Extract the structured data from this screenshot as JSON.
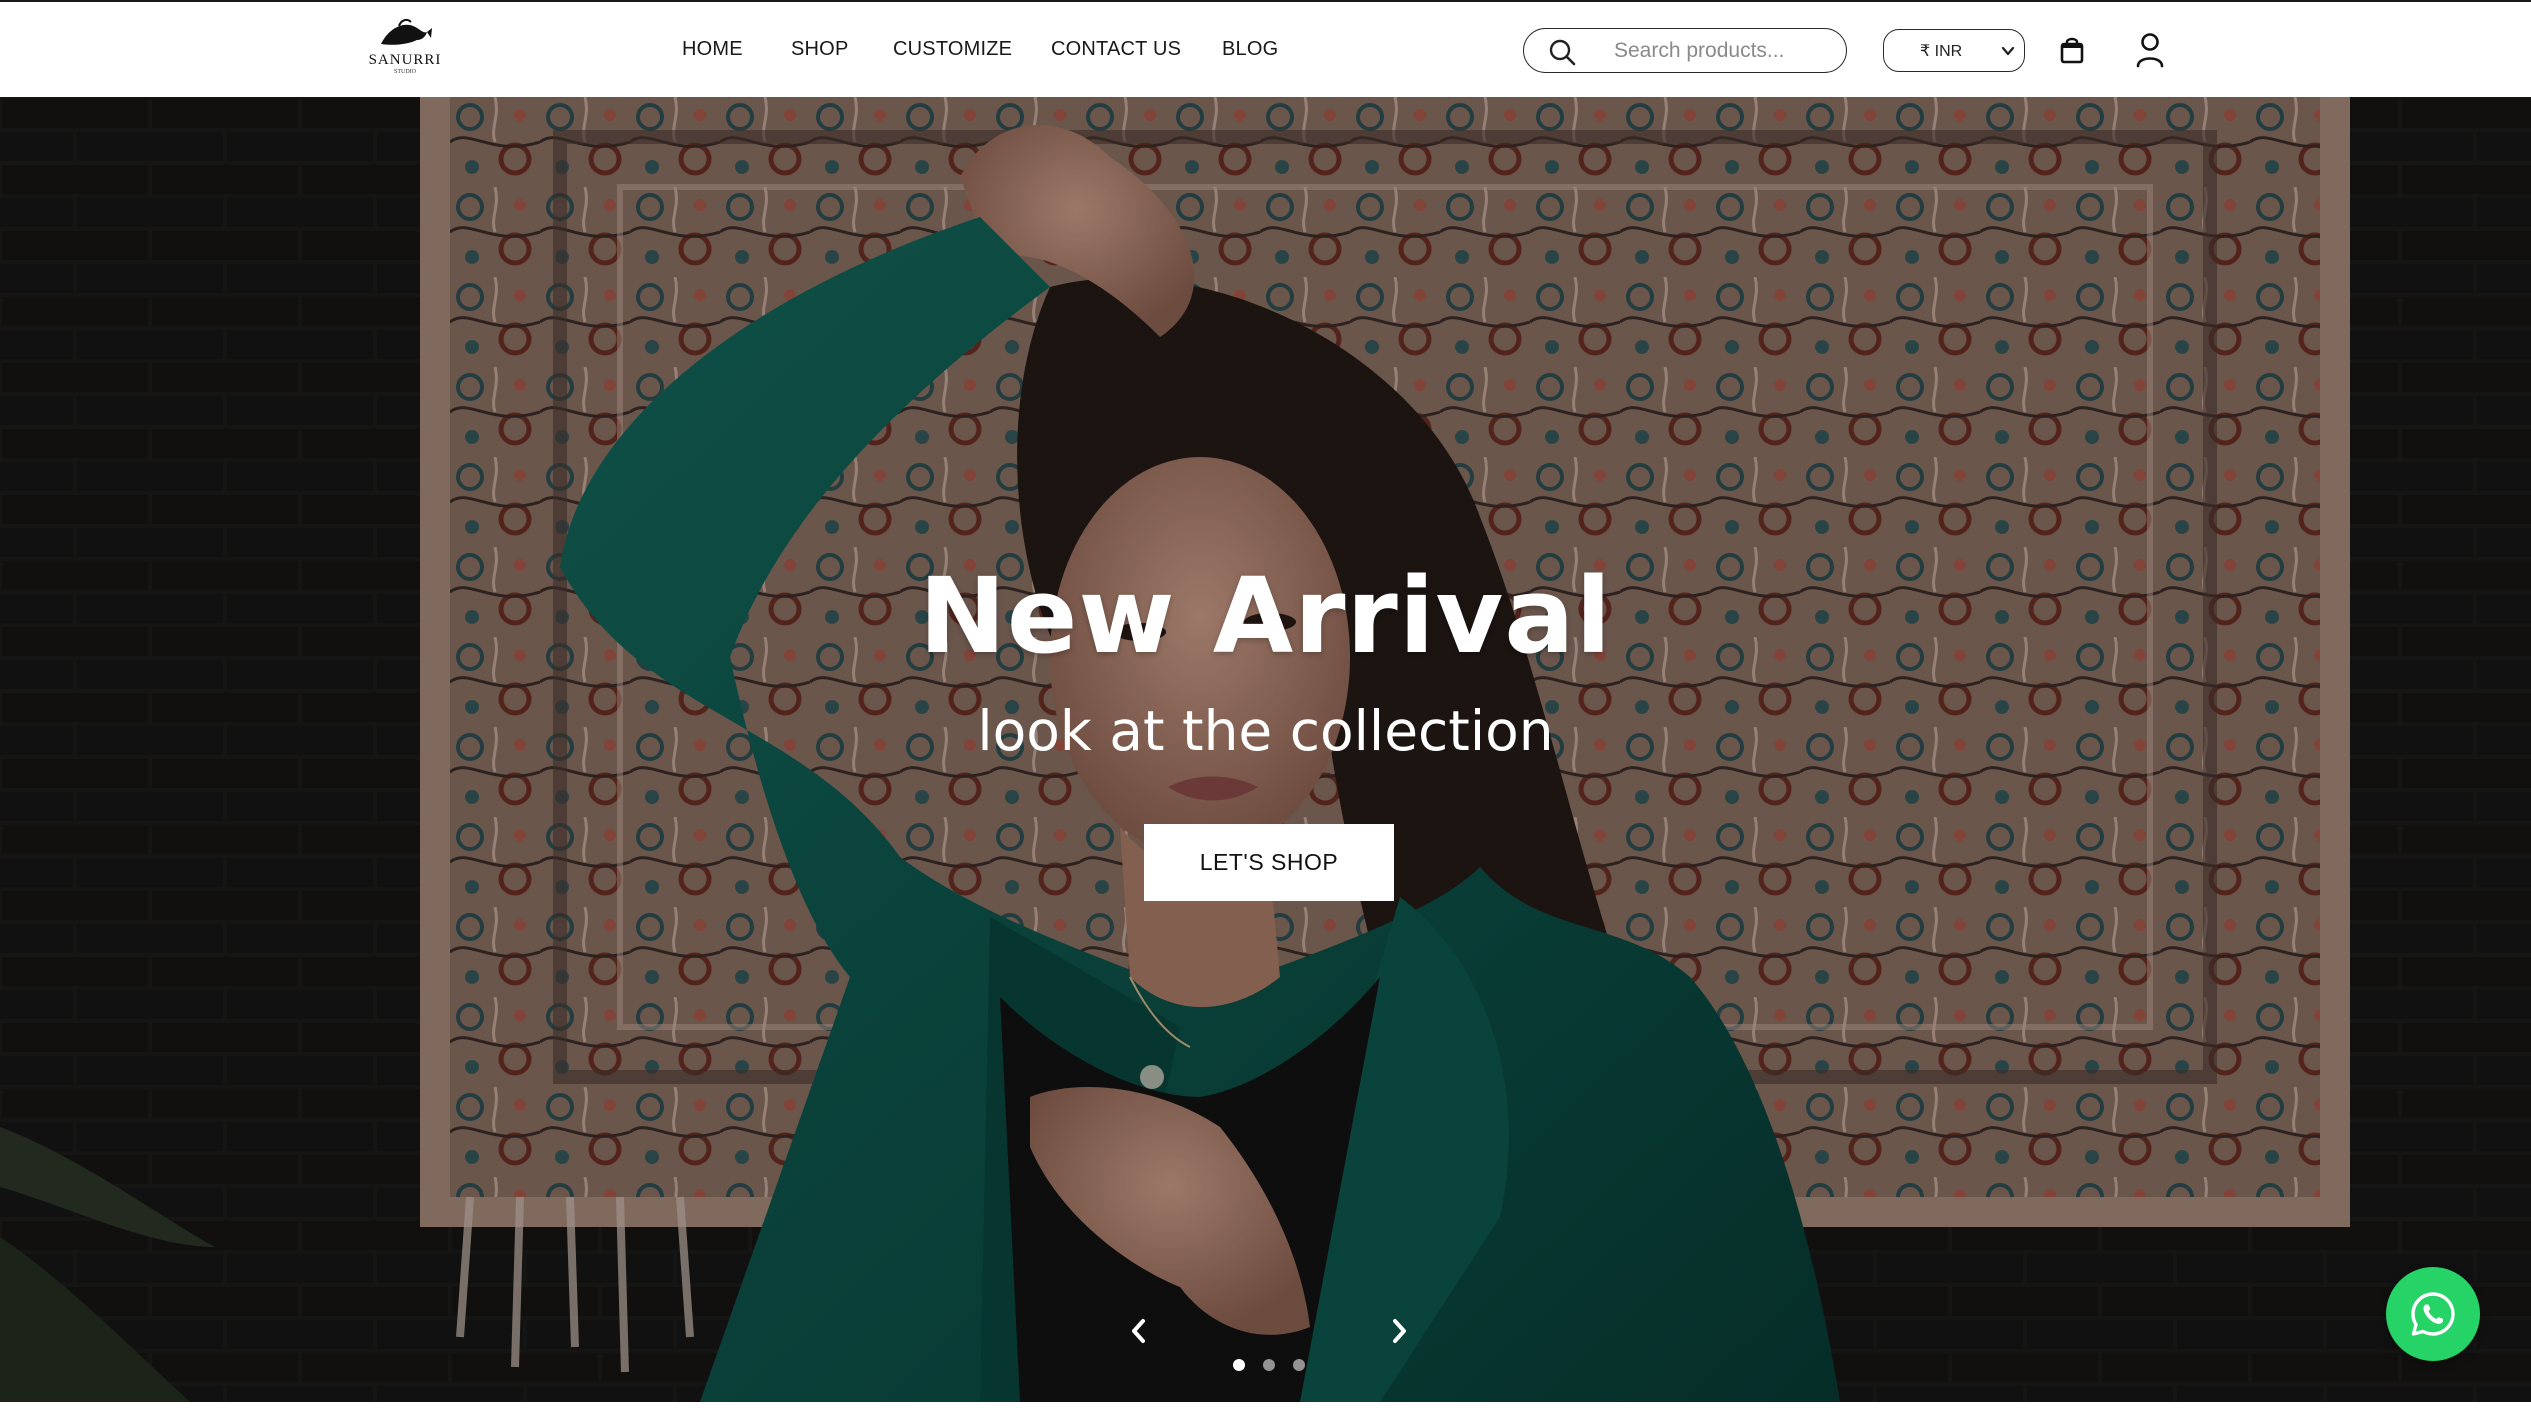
{
  "header": {
    "logo": {
      "name": "SANURRI",
      "sub": "STUDIO"
    },
    "nav": [
      {
        "label": "HOME"
      },
      {
        "label": "SHOP"
      },
      {
        "label": "CUSTOMIZE"
      },
      {
        "label": "CONTACT US"
      },
      {
        "label": "BLOG"
      }
    ],
    "search": {
      "placeholder": "Search products...",
      "icon": "search-icon"
    },
    "currency": {
      "selected": "₹ INR"
    },
    "cart_icon": "shopping-bag-icon",
    "account_icon": "user-icon"
  },
  "hero": {
    "title": "New Arrival",
    "subtitle": "look at the collection",
    "button_label": "LET'S SHOP",
    "slides_total": 3,
    "active_slide": 1,
    "prev_icon": "chevron-left-icon",
    "next_icon": "chevron-right-icon"
  },
  "floating": {
    "whatsapp_icon": "whatsapp-icon"
  },
  "colors": {
    "accent_whatsapp": "#25d366",
    "jacket_green": "#0f5a50",
    "text_dark": "#1a1a1a"
  }
}
